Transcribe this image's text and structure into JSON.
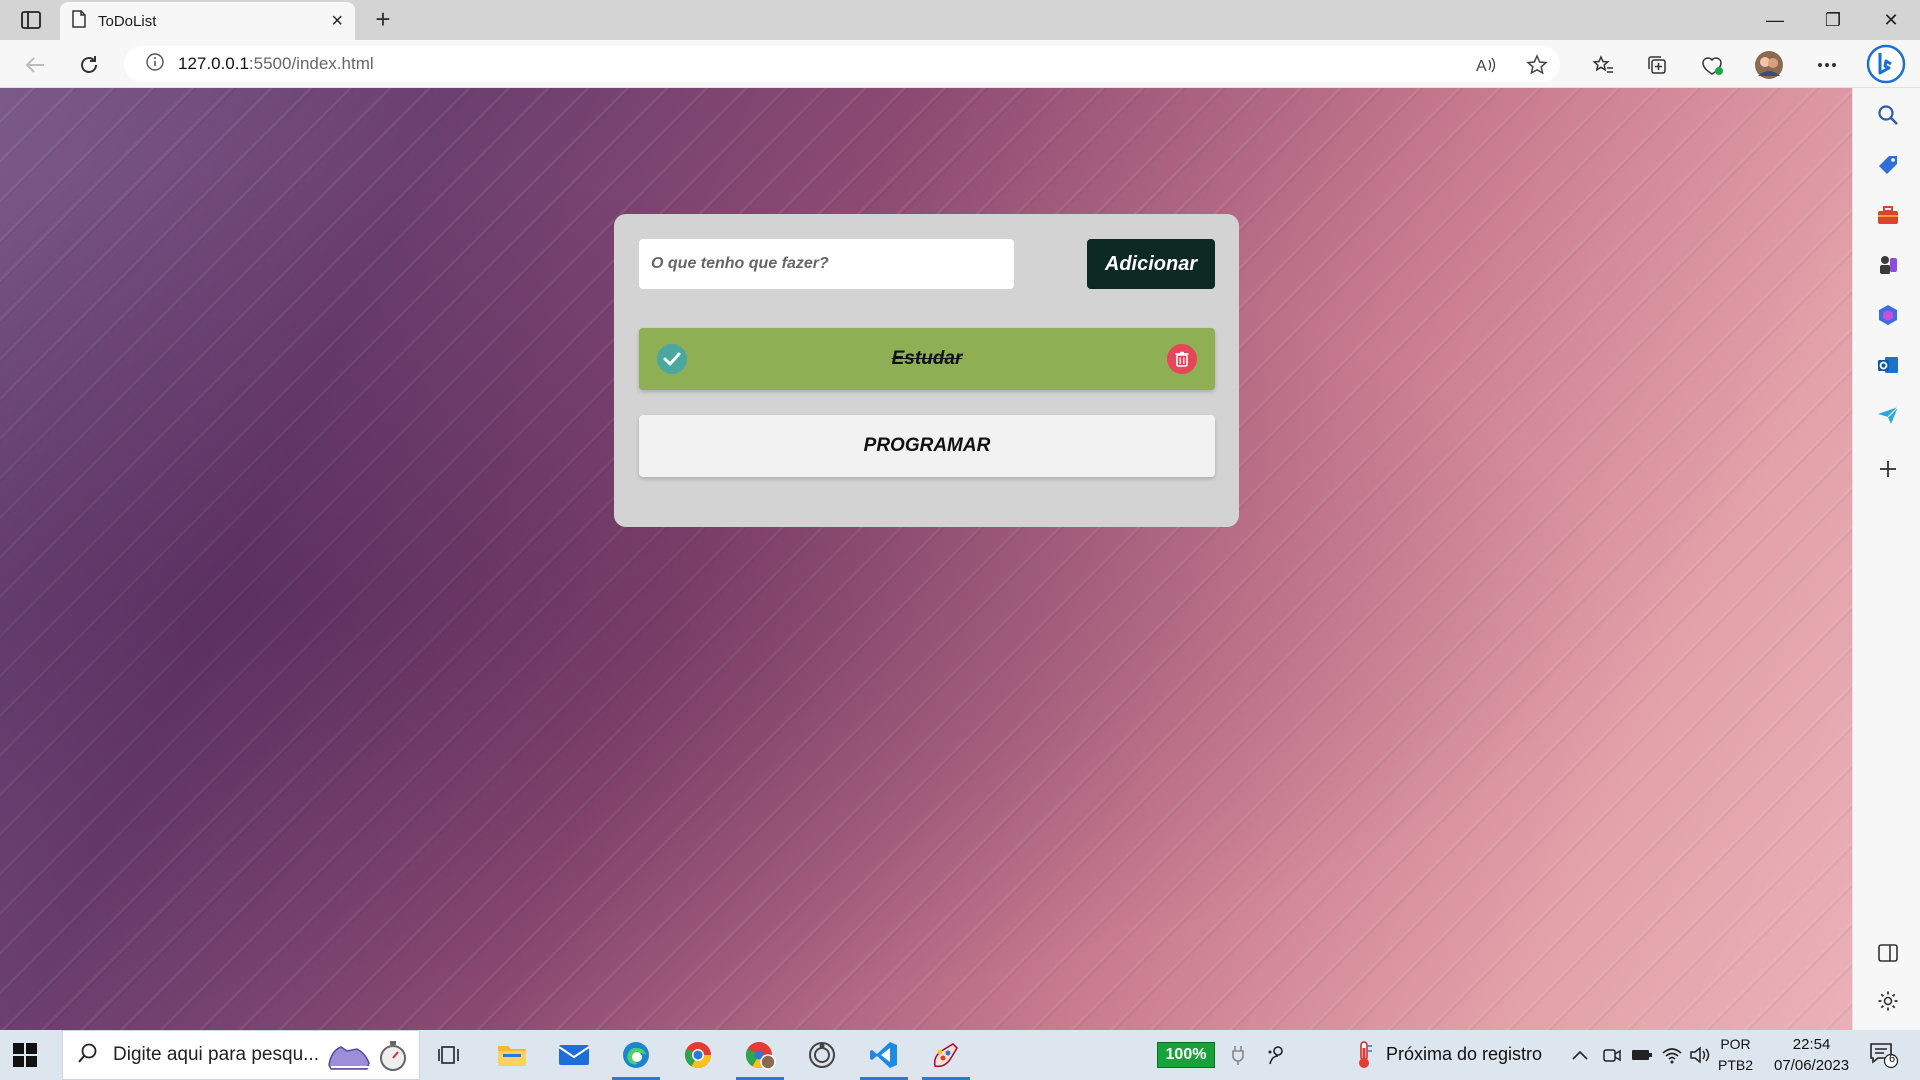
{
  "browser": {
    "tab_title": "ToDoList",
    "tab_close": "×",
    "new_tab": "+",
    "url_host": "127.0.0.1",
    "url_path": ":5500/index.html",
    "window_minimize": "—",
    "window_maximize": "❐",
    "window_close": "✕"
  },
  "todo": {
    "input_placeholder": "O que tenho que fazer?",
    "add_button": "Adicionar",
    "tasks": [
      {
        "label": "Estudar",
        "done": true
      },
      {
        "label": "PROGRAMAR",
        "done": false
      }
    ]
  },
  "colors": {
    "card_bg": "#d3d3d3",
    "add_button_bg": "#0d2a22",
    "task_done_bg": "#8faf55",
    "task_pending_bg": "#f2f2f2",
    "check_icon": "#4aa8a0",
    "trash_icon": "#e8455a"
  },
  "taskbar": {
    "search_placeholder": "Digite aqui para pesqu...",
    "battery": "100%",
    "weather_text": "Próxima do registro",
    "lang_top": "POR",
    "lang_bottom": "PTB2",
    "time": "22:54",
    "date": "07/06/2023",
    "notifications": "6"
  }
}
